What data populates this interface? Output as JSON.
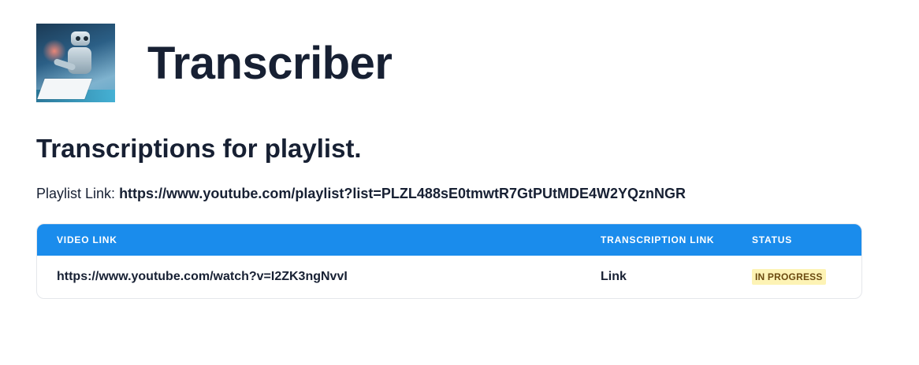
{
  "app": {
    "title": "Transcriber",
    "logo_icon": "robot-writing-icon"
  },
  "page": {
    "section_title": "Transcriptions for playlist.",
    "playlist_label": "Playlist Link:",
    "playlist_url": "https://www.youtube.com/playlist?list=PLZL488sE0tmwtR7GtPUtMDE4W2YQznNGR"
  },
  "table": {
    "header_color": "#1a8cec",
    "columns": [
      "VIDEO LINK",
      "TRANSCRIPTION LINK",
      "STATUS"
    ],
    "rows": [
      {
        "video_link": "https://www.youtube.com/watch?v=I2ZK3ngNvvI",
        "transcription_link": "Link",
        "status": "IN PROGRESS",
        "status_color": "#fdf3b5"
      }
    ]
  }
}
